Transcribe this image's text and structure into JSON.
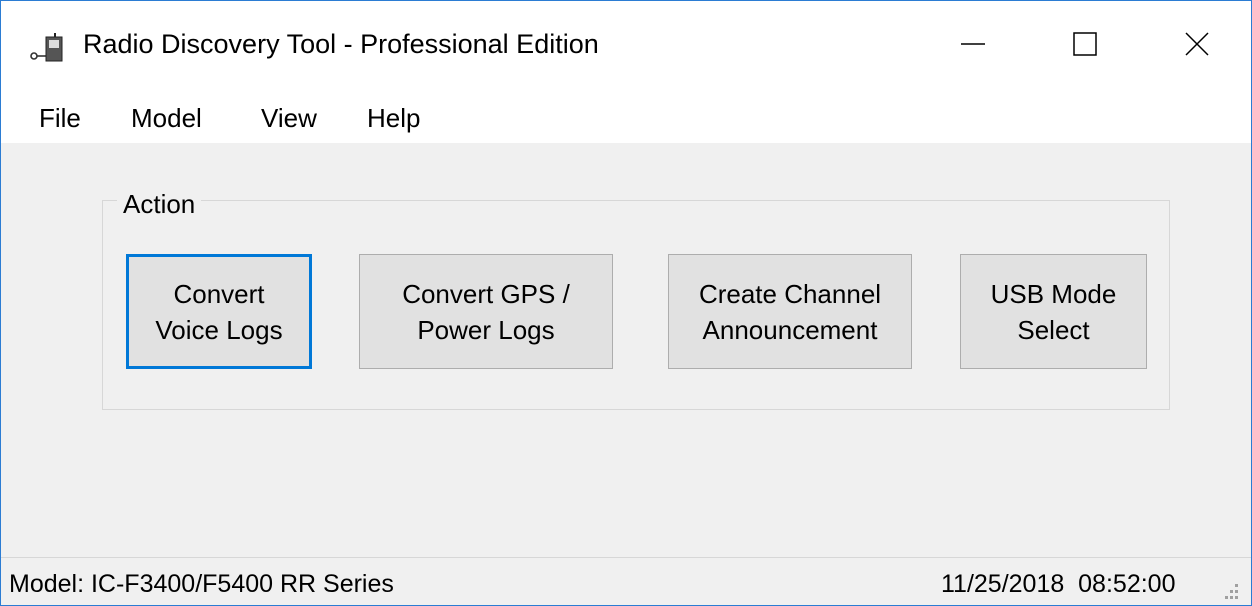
{
  "window": {
    "title": "Radio Discovery Tool - Professional Edition",
    "app_icon": "radio-app-icon",
    "accent_color": "#0078d7"
  },
  "menu": {
    "items": [
      {
        "label": "File"
      },
      {
        "label": "Model"
      },
      {
        "label": "View"
      },
      {
        "label": "Help"
      }
    ]
  },
  "action_group": {
    "label": "Action",
    "buttons": [
      {
        "label": "Convert\nVoice Logs",
        "focused": true
      },
      {
        "label": "Convert GPS /\nPower Logs",
        "focused": false
      },
      {
        "label": "Create Channel\nAnnouncement",
        "focused": false
      },
      {
        "label": "USB Mode\nSelect",
        "focused": false
      }
    ]
  },
  "status": {
    "model": "Model: IC-F3400/F5400 RR Series",
    "datetime": "11/25/2018  08:52:00"
  }
}
